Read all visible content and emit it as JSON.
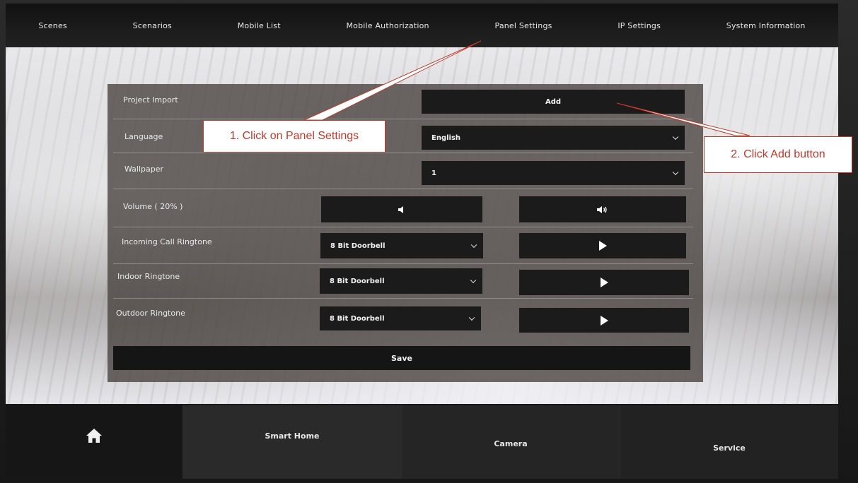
{
  "top_nav": {
    "tabs": [
      "Scenes",
      "Scenarios",
      "Mobile List",
      "Mobile Authorization",
      "Panel Settings",
      "IP Settings",
      "System Information"
    ]
  },
  "settings": {
    "project_import": {
      "label": "Project Import",
      "button": "Add"
    },
    "language": {
      "label": "Language",
      "value": "English"
    },
    "wallpaper": {
      "label": "Wallpaper",
      "value": "1"
    },
    "volume": {
      "label": "Volume ( 20% )",
      "level_percent": 20
    },
    "incoming_call": {
      "label": "Incoming Call Ringtone",
      "value": "8 Bit Doorbell"
    },
    "indoor": {
      "label": "Indoor Ringtone",
      "value": "8 Bit Doorbell"
    },
    "outdoor": {
      "label": "Outdoor Ringtone",
      "value": "8 Bit Doorbell"
    },
    "save": "Save"
  },
  "bottom_bar": {
    "smart_home": "Smart Home",
    "camera": "Camera",
    "service": "Service"
  },
  "annotations": {
    "step1": "1. Click on Panel Settings",
    "step2": "2. Click Add button",
    "color": "#c0392b"
  },
  "icons": [
    "home-icon",
    "volume-down-icon",
    "volume-up-icon",
    "play-icon",
    "chevron-down-icon"
  ]
}
